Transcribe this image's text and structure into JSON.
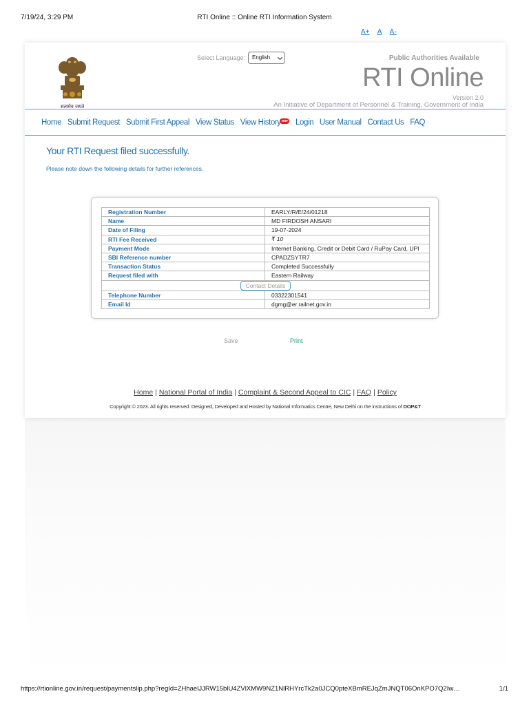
{
  "print_header": {
    "datetime": "7/19/24, 3:29 PM",
    "title": "RTI Online :: Online RTI Information System"
  },
  "font_sizer": [
    "A+",
    "A",
    "A-"
  ],
  "emblem": {
    "icon": "ashoka-emblem-icon",
    "motto": "सत्यमेव जयते"
  },
  "header": {
    "language_label": "Select Language:",
    "language_selected": "English",
    "public_authorities": "Public Authorities Available",
    "brand": "RTI Online",
    "version": "Version 2.0",
    "tagline": "An Initiative of Department of Personnel & Training, Government of India"
  },
  "nav": {
    "items": [
      "Home",
      "Submit Request",
      "Submit First Appeal",
      "View Status",
      "View History",
      "Login",
      "User Manual",
      "Contact Us",
      "FAQ"
    ],
    "new_badge": "new"
  },
  "main": {
    "title": "Your RTI Request filed successfully.",
    "note": "Please note down the following details for further references."
  },
  "details": {
    "rows": [
      {
        "label": "Registration Number",
        "value": "EARLY/R/E/24/01218"
      },
      {
        "label": "Name",
        "value": "MD FIRDOSH ANSARI"
      },
      {
        "label": "Date of Filing",
        "value": "19-07-2024"
      },
      {
        "label": "RTI Fee Received",
        "value": "₹ 10"
      },
      {
        "label": "Payment Mode",
        "value": "Internet Banking, Credit or Debit Card / RuPay Card, UPI"
      },
      {
        "label": "SBI Reference number",
        "value": "CPADZSYTR7"
      },
      {
        "label": "Transaction Status",
        "value": "Completed Successfully"
      },
      {
        "label": "Request filed with",
        "value": "Eastern Railway"
      }
    ],
    "contact_heading": "Contact Details",
    "contact_rows": [
      {
        "label": "Telephone Number",
        "value": "03322301541"
      },
      {
        "label": "Email Id",
        "value": "dgmg@er.railnet.gov.in"
      }
    ]
  },
  "actions": {
    "save": "Save",
    "print": "Print"
  },
  "footer": {
    "links": [
      "Home",
      "National Portal of India",
      "Complaint & Second Appeal to CIC",
      "FAQ",
      "Policy"
    ],
    "copyright": "Copyright © 2023. All rights reserved. Designed, Developed and Hosted by National Informatics Centre, New Delhi on the instructions of",
    "copyright_bold": "DOP&T"
  },
  "print_footer": {
    "url": "https://rtionline.gov.in/request/paymentslip.php?regId=ZHhaelJJRW15blU4ZVlXMW9NZ1NlRHYrcTk2a0JCQ0pteXBmREJqZmJNQT06OnKPO7Q2Iw…",
    "page": "1/1"
  }
}
